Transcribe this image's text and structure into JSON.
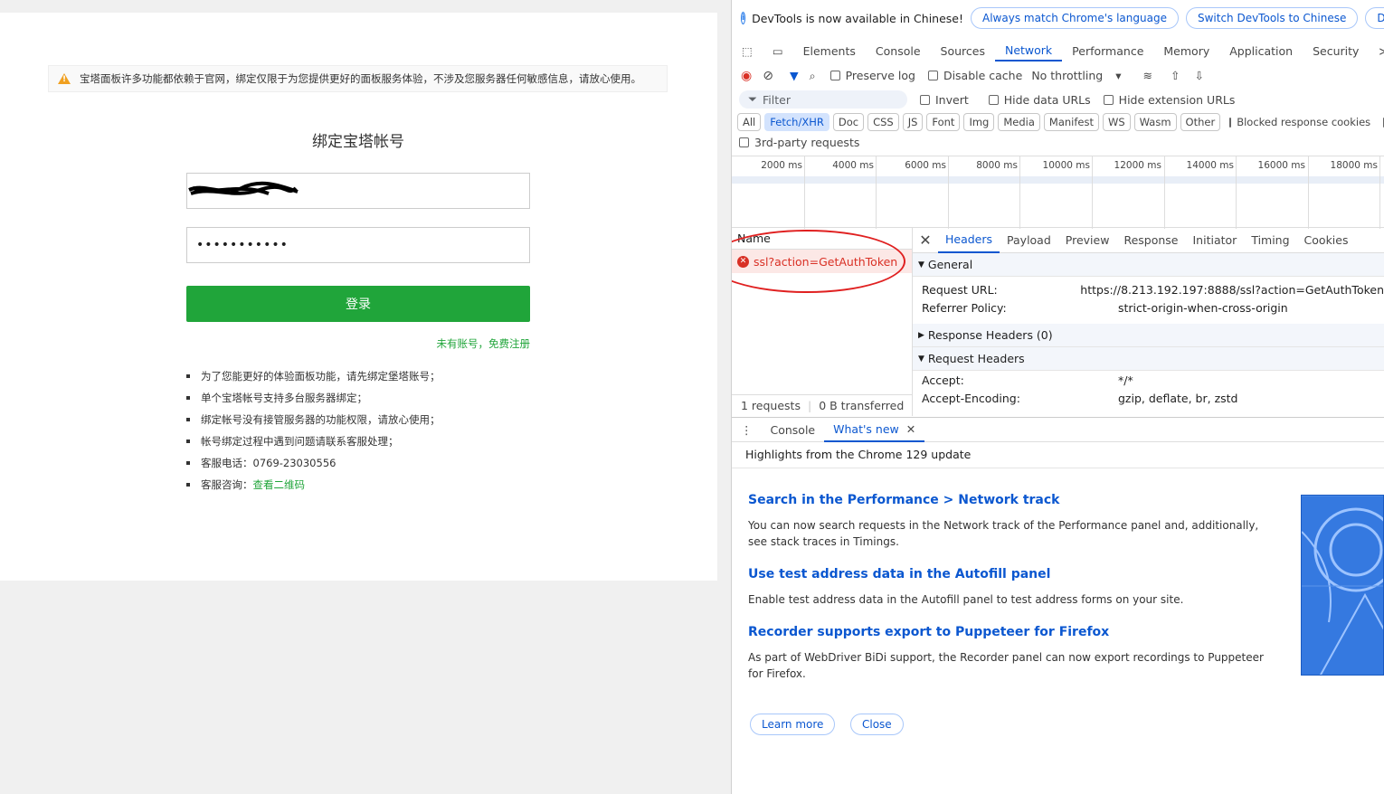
{
  "page": {
    "warning": "宝塔面板许多功能都依赖于官网，绑定仅限于为您提供更好的面板服务体验，不涉及您服务器任何敏感信息，请放心使用。",
    "title": "绑定宝塔帐号",
    "password_value": "•••••••••••",
    "login_label": "登录",
    "register_link": "未有账号，免费注册",
    "notes": [
      "为了您能更好的体验面板功能，请先绑定堡塔账号；",
      "单个宝塔帐号支持多台服务器绑定；",
      "绑定帐号没有接管服务器的功能权限，请放心使用；",
      "帐号绑定过程中遇到问题请联系客服处理；",
      "客服电话：0769-23030556"
    ],
    "consult_prefix": "客服咨询：",
    "consult_link": "查看二维码"
  },
  "devtools": {
    "infobar": {
      "text": "DevTools is now available in Chinese!",
      "btn1": "Always match Chrome's language",
      "btn2": "Switch DevTools to Chinese",
      "btn3": "Don't show"
    },
    "tabs": [
      "Elements",
      "Console",
      "Sources",
      "Network",
      "Performance",
      "Memory",
      "Application",
      "Security"
    ],
    "active_tab": "Network",
    "toolbar": {
      "preserve_log": "Preserve log",
      "disable_cache": "Disable cache",
      "throttling": "No throttling"
    },
    "filter": {
      "placeholder": "Filter",
      "invert": "Invert",
      "hide_data": "Hide data URLs",
      "hide_ext": "Hide extension URLs"
    },
    "types": [
      "All",
      "Fetch/XHR",
      "Doc",
      "CSS",
      "JS",
      "Font",
      "Img",
      "Media",
      "Manifest",
      "WS",
      "Wasm",
      "Other"
    ],
    "active_type": "Fetch/XHR",
    "blocked_cookies": "Blocked response cookies",
    "third_party": "3rd-party requests",
    "timeline_ticks": [
      "2000 ms",
      "4000 ms",
      "6000 ms",
      "8000 ms",
      "10000 ms",
      "12000 ms",
      "14000 ms",
      "16000 ms",
      "18000 ms"
    ],
    "list": {
      "name_header": "Name",
      "request": "ssl?action=GetAuthToken",
      "requests": "1 requests",
      "transferred": "0 B transferred"
    },
    "detail": {
      "tabs": [
        "Headers",
        "Payload",
        "Preview",
        "Response",
        "Initiator",
        "Timing",
        "Cookies"
      ],
      "active": "Headers",
      "general": "General",
      "request_url_k": "Request URL:",
      "request_url_v": "https://8.213.192.197:8888/ssl?action=GetAuthToken",
      "referrer_k": "Referrer Policy:",
      "referrer_v": "strict-origin-when-cross-origin",
      "response_headers": "Response Headers (0)",
      "request_headers": "Request Headers",
      "accept_k": "Accept:",
      "accept_v": "*/*",
      "encoding_k": "Accept-Encoding:",
      "encoding_v": "gzip, deflate, br, zstd"
    },
    "drawer": {
      "console": "Console",
      "whats_new": "What's new",
      "highlights": "Highlights from the Chrome 129 update",
      "articles": [
        {
          "title": "Search in the Performance > Network track",
          "body": "You can now search requests in the Network track of the Performance panel and, additionally, see stack traces in Timings."
        },
        {
          "title": "Use test address data in the Autofill panel",
          "body": "Enable test address data in the Autofill panel to test address forms on your site."
        },
        {
          "title": "Recorder supports export to Puppeteer for Firefox",
          "body": "As part of WebDriver BiDi support, the Recorder panel can now export recordings to Puppeteer for Firefox."
        }
      ],
      "learn_more": "Learn more",
      "close": "Close"
    }
  }
}
